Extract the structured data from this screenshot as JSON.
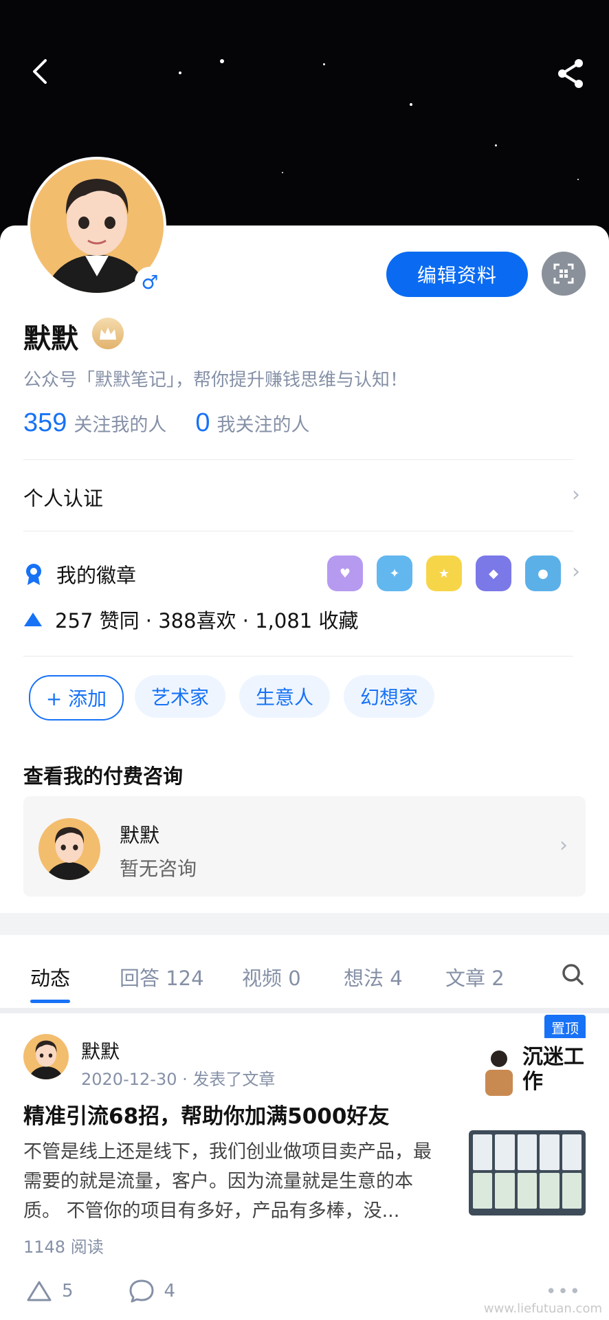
{
  "header": {
    "back_icon": "chevron-left-icon",
    "share_icon": "share-icon"
  },
  "profile": {
    "name": "默默",
    "gender_symbol": "♂",
    "edit_button": "编辑资料",
    "qr_icon": "qr-scan-icon",
    "bio": "公众号「默默笔记」，帮你提升赚钱思维与认知！",
    "followers_count": "359",
    "followers_label": "关注我的人",
    "following_count": "0",
    "following_label": "我关注的人"
  },
  "verification": {
    "label": "个人认证"
  },
  "badges": {
    "label": "我的徽章",
    "count_items": 5,
    "summary": "257 赞同 · 388喜欢 · 1,081 收藏"
  },
  "tags": {
    "add_label": "+ 添加",
    "items": [
      "艺术家",
      "生意人",
      "幻想家"
    ]
  },
  "consult": {
    "section_title": "查看我的付费咨询",
    "name": "默默",
    "status": "暂无咨询"
  },
  "tabs": [
    {
      "label": "动态"
    },
    {
      "label": "回答 124"
    },
    {
      "label": "视频 0"
    },
    {
      "label": "想法 4"
    },
    {
      "label": "文章 2"
    }
  ],
  "feed": {
    "pin_label": "置顶",
    "author": "默默",
    "meta": "2020-12-30 · 发表了文章",
    "title": "精准引流68招，帮助你加满5000好友",
    "body": "不管是线上还是线下，我们创业做项目卖产品，最需要的就是流量，客户。因为流量就是生意的本质。 不管你的项目有多好，产品有多棒，没...",
    "reads": "1148 阅读",
    "likes": "5",
    "comments": "4",
    "thumb_text": "沉迷工作"
  },
  "watermark": "www.liefutuan.com",
  "colors": {
    "accent": "#1772f6",
    "button_blue": "#0a6bf2",
    "cover_bg": "#050508",
    "avatar_bg": "#f3bd6e"
  }
}
